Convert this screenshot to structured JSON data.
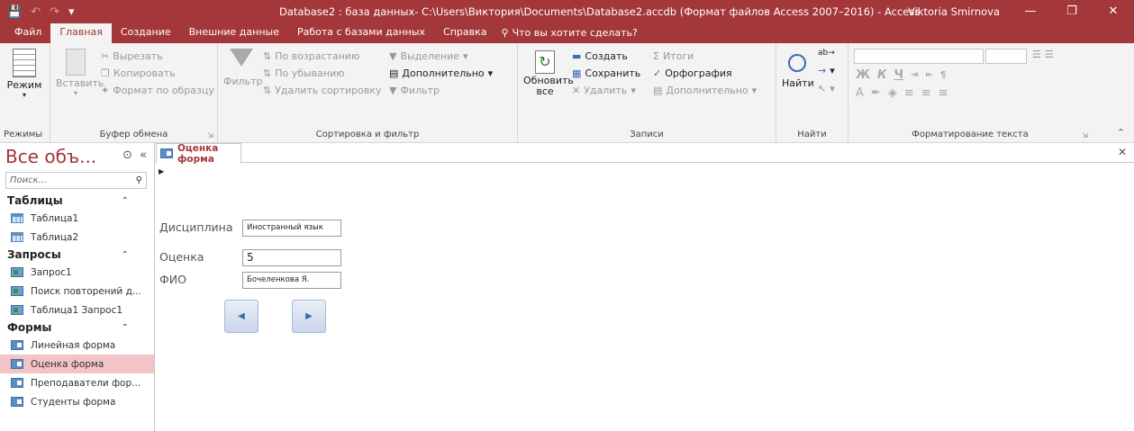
{
  "titlebar": {
    "title": "Database2 : база данных- C:\\Users\\Виктория\\Documents\\Database2.accdb (Формат файлов Access 2007–2016)  -  Access",
    "user": "Viktoria Smirnova"
  },
  "tabs": [
    "Файл",
    "Главная",
    "Создание",
    "Внешние данные",
    "Работа с базами данных",
    "Справка"
  ],
  "tell_me": "Что вы хотите сделать?",
  "ribbon": {
    "views": {
      "mode": "Режим",
      "label": "Режимы"
    },
    "clipboard": {
      "paste": "Вставить",
      "cut": "Вырезать",
      "copy": "Копировать",
      "format_painter": "Формат по образцу",
      "label": "Буфер обмена"
    },
    "sort": {
      "filter": "Фильтр",
      "ascending": "По возрастанию",
      "descending": "По убыванию",
      "remove_sort": "Удалить сортировку",
      "selection": "Выделение",
      "advanced": "Дополнительно",
      "toggle_filter": "Фильтр",
      "label": "Сортировка и фильтр"
    },
    "records": {
      "refresh": "Обновить все",
      "new": "Создать",
      "save": "Сохранить",
      "delete": "Удалить",
      "totals": "Итоги",
      "spelling": "Орфография",
      "more": "Дополнительно",
      "label": "Записи"
    },
    "find": {
      "find": "Найти",
      "label": "Найти"
    },
    "text": {
      "label": "Форматирование текста"
    }
  },
  "nav": {
    "title": "Все объ...",
    "search_placeholder": "Поиск...",
    "groups": [
      {
        "name": "Таблицы",
        "items": [
          "Таблица1",
          "Таблица2"
        ]
      },
      {
        "name": "Запросы",
        "items": [
          "Запрос1",
          "Поиск повторений д...",
          "Таблица1 Запрос1"
        ]
      },
      {
        "name": "Формы",
        "items": [
          "Линейная форма",
          "Оценка форма",
          "Преподаватели фор...",
          "Студенты форма"
        ]
      }
    ]
  },
  "document": {
    "tab": "Оценка форма",
    "fields": {
      "discipline_label": "Дисциплина",
      "discipline_value": "Иностранный язык",
      "grade_label": "Оценка",
      "grade_value": "5",
      "fio_label": "ФИО",
      "fio_value": "Бочеленкова Я."
    }
  },
  "colors": {
    "accent": "#a4373a",
    "selected_nav": "#f4c3c5"
  }
}
